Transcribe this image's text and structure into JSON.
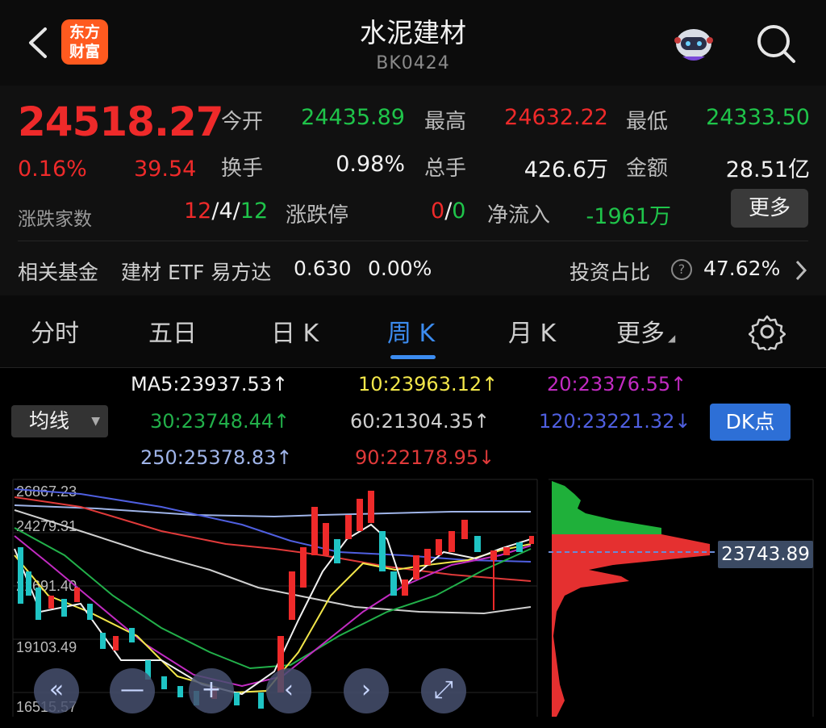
{
  "header": {
    "logo_text_1": "东方",
    "logo_text_2": "财富",
    "title": "水泥建材",
    "code": "BK0424"
  },
  "quote": {
    "price": "24518.27",
    "change_pct": "0.16%",
    "change": "39.54",
    "open_label": "今开",
    "open": "24435.89",
    "high_label": "最高",
    "high": "24632.22",
    "low_label": "最低",
    "low": "24333.50",
    "turnover_label": "换手",
    "turnover": "0.98%",
    "volume_label": "总手",
    "volume": "426.6万",
    "amount_label": "金额",
    "amount": "28.51亿",
    "updown_label": "涨跌家数",
    "up_count": "12",
    "flat_count": "4",
    "down_count": "12",
    "limit_label": "涨跌停",
    "limit_up": "0",
    "limit_down": "0",
    "netflow_label": "净流入",
    "netflow": "-1961万",
    "more_label": "更多",
    "fund_label": "相关基金",
    "fund_name": "建材 ETF 易方达",
    "fund_price": "0.630",
    "fund_change": "0.00%",
    "invest_label": "投资占比",
    "invest_value": "47.62%",
    "help_icon_text": "?"
  },
  "tabs": [
    {
      "label": "分时"
    },
    {
      "label": "五日"
    },
    {
      "label": "日 K"
    },
    {
      "label": "周 K"
    },
    {
      "label": "月 K"
    },
    {
      "label": "更多"
    }
  ],
  "ma": {
    "select_label": "均线",
    "ma5": "MA5:23937.53↑",
    "ma10": "10:23963.12↑",
    "ma20": "20:23376.55↑",
    "ma30": "30:23748.44↑",
    "ma60": "60:21304.35↑",
    "ma120": "120:23221.32↓",
    "ma250": "250:25378.83↑",
    "ma90": "90:22178.95↓",
    "dk_label": "DK点",
    "colors": {
      "ma5": "#f2f2f2",
      "ma10": "#f2e64a",
      "ma20": "#c22bc2",
      "ma30": "#22b04a",
      "ma60": "#cfcfcf",
      "ma120": "#4f5fe0",
      "ma250": "#9fb4e8",
      "ma90": "#e03a3a"
    }
  },
  "chart": {
    "y_labels": [
      "26867.23",
      "24279.31",
      "21691.40",
      "19103.49",
      "16515.57"
    ],
    "current_price_tag": "23743.89",
    "nav_buttons": [
      "«",
      "—",
      "+",
      "‹",
      "›",
      "⤢"
    ]
  }
}
